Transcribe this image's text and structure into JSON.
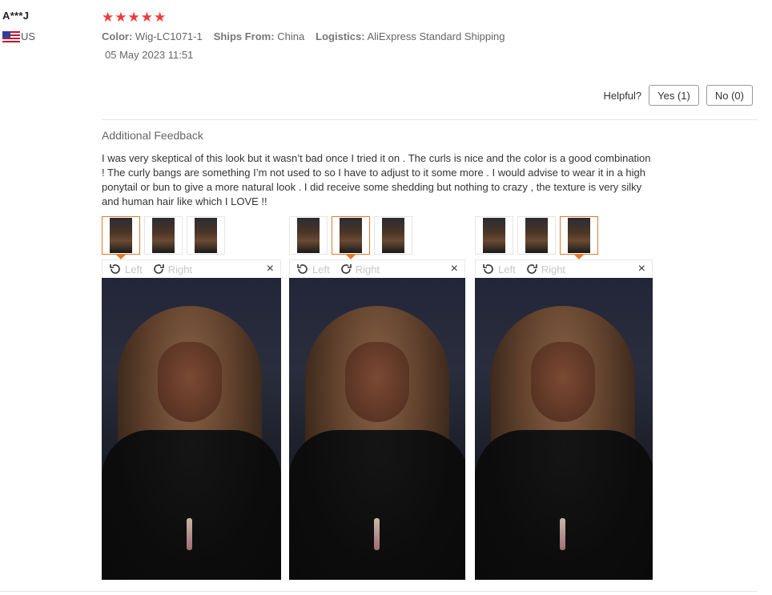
{
  "user": {
    "name": "A***J",
    "country": "US"
  },
  "review": {
    "rating_stars": "★★★★★",
    "color_label": "Color:",
    "color_value": "Wig-LC1071-1",
    "ships_label": "Ships From:",
    "ships_value": "China",
    "logistics_label": "Logistics:",
    "logistics_value": "AliExpress Standard Shipping",
    "date": "05 May 2023 11:51"
  },
  "helpful": {
    "label": "Helpful?",
    "yes_label": "Yes (1)",
    "no_label": "No (0)"
  },
  "feedback": {
    "title": "Additional Feedback",
    "text": "I was very skeptical of this look but it wasn’t bad once I tried it on . The curls is nice and the color is a good combination ! The curly bangs are something I’m not used to so I have to adjust to it some more . I would advise to wear it in a high ponytail or bun to give a more natural look . I did receive some shedding but nothing to crazy , the texture is very silky and human hair like which I LOVE !!"
  },
  "viewer": {
    "left_label": "Left",
    "right_label": "Right",
    "close_label": "×"
  },
  "colors": {
    "accent": "#e4792d",
    "star": "#ef3b3b"
  }
}
